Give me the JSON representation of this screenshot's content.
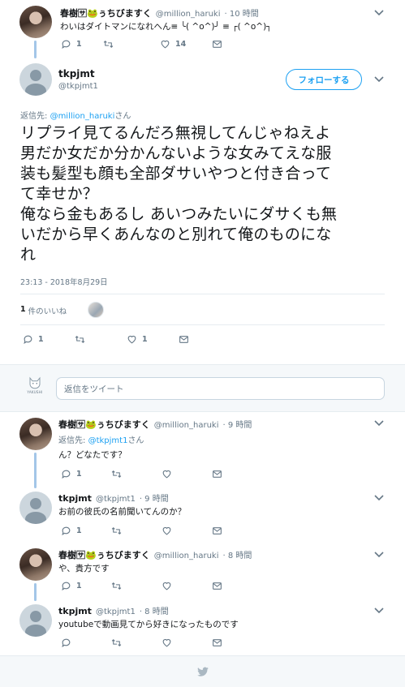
{
  "top_tweet": {
    "display_name": "春樹🈂🐸ぅちびますく",
    "handle": "@million_haruki",
    "time": "· 10 時間",
    "text": "わいはダイトマンになれへん≡ ╰( ^o^)╯ ≡ ┌( ^o^)┐",
    "reply_count": "1",
    "like_count": "14"
  },
  "main_tweet": {
    "display_name": "tkpjmt",
    "handle": "@tkpjmt1",
    "follow_label": "フォローする",
    "reply_to_prefix": "返信先: ",
    "reply_to_handle": "@million_haruki",
    "reply_to_suffix": "さん",
    "text_lines": [
      "リプライ見てるんだろ無視してんじゃねえよ",
      "男だか女だか分かんないような女みてえな服",
      "装も髪型も顔も全部ダサいやつと付き合って",
      "て幸せか？",
      "俺なら金もあるし あいつみたいにダサくも無",
      "いだから早くあんなのと別れて俺のものにな",
      "れ"
    ],
    "timestamp": "23:13 - 2018年8月29日",
    "likes_count": "1",
    "likes_label": "件のいいね",
    "reply_count": "1",
    "like_count": "1"
  },
  "compose": {
    "placeholder": "返信をツイート",
    "avatar_caption": "YAKUSHI"
  },
  "replies": [
    {
      "display_name": "春樹🈂🐸ぅちびますく",
      "handle": "@million_haruki",
      "time": "· 9 時間",
      "reply_to_prefix": "返信先: ",
      "reply_to_handle": "@tkpjmt1",
      "reply_to_suffix": "さん",
      "text": "ん？どなたです？",
      "reply_count": "1"
    },
    {
      "display_name": "tkpjmt",
      "handle": "@tkpjmt1",
      "time": "· 9 時間",
      "text": "お前の彼氏の名前聞いてんのか？",
      "reply_count": "1"
    },
    {
      "display_name": "春樹🈂🐸ぅちびますく",
      "handle": "@million_haruki",
      "time": "· 8 時間",
      "text": "や、貴方です",
      "reply_count": "1"
    },
    {
      "display_name": "tkpjmt",
      "handle": "@tkpjmt1",
      "time": "· 8 時間",
      "text": "youtubeで動画見てから好きになったものです",
      "reply_count": ""
    }
  ],
  "colors": {
    "accent": "#1da1f2",
    "thread_line": "#a3c6e8",
    "text": "#14171a",
    "muted": "#657786",
    "divider": "#e6ecf0"
  }
}
